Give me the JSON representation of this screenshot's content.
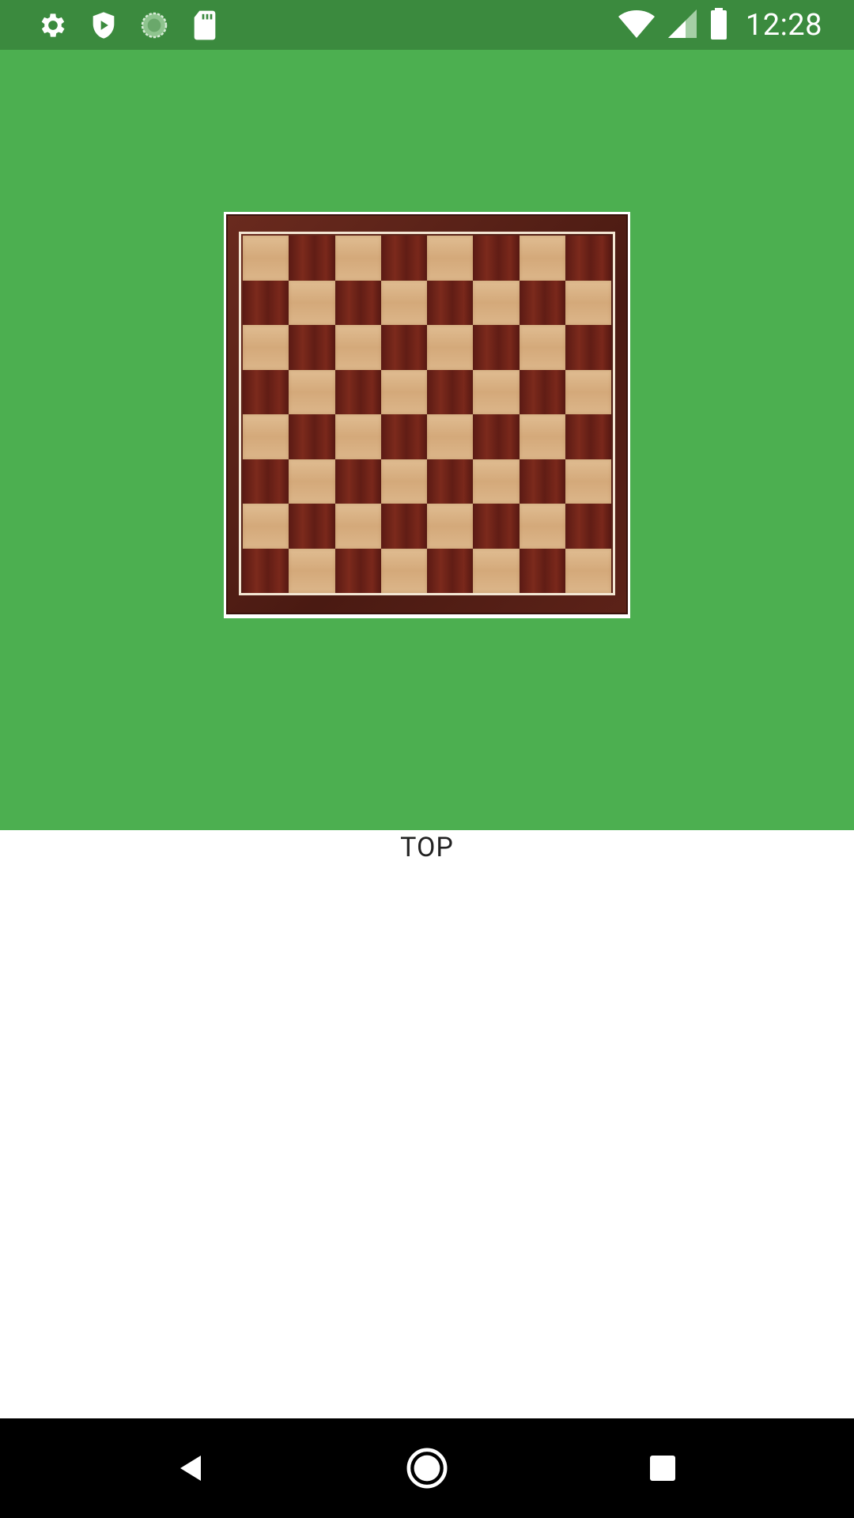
{
  "status_bar": {
    "time": "12:28",
    "left_icons": [
      "settings-icon",
      "shield-icon",
      "sync-icon",
      "sd-card-icon"
    ],
    "right_icons": [
      "wifi-icon",
      "signal-icon",
      "battery-icon"
    ],
    "background_color": "#3b8a3e"
  },
  "main": {
    "panel_color": "#4caf50",
    "board_image": "chessboard-image",
    "label": "TOP"
  },
  "nav_bar": {
    "buttons": [
      "back-button",
      "home-button",
      "recents-button"
    ]
  }
}
